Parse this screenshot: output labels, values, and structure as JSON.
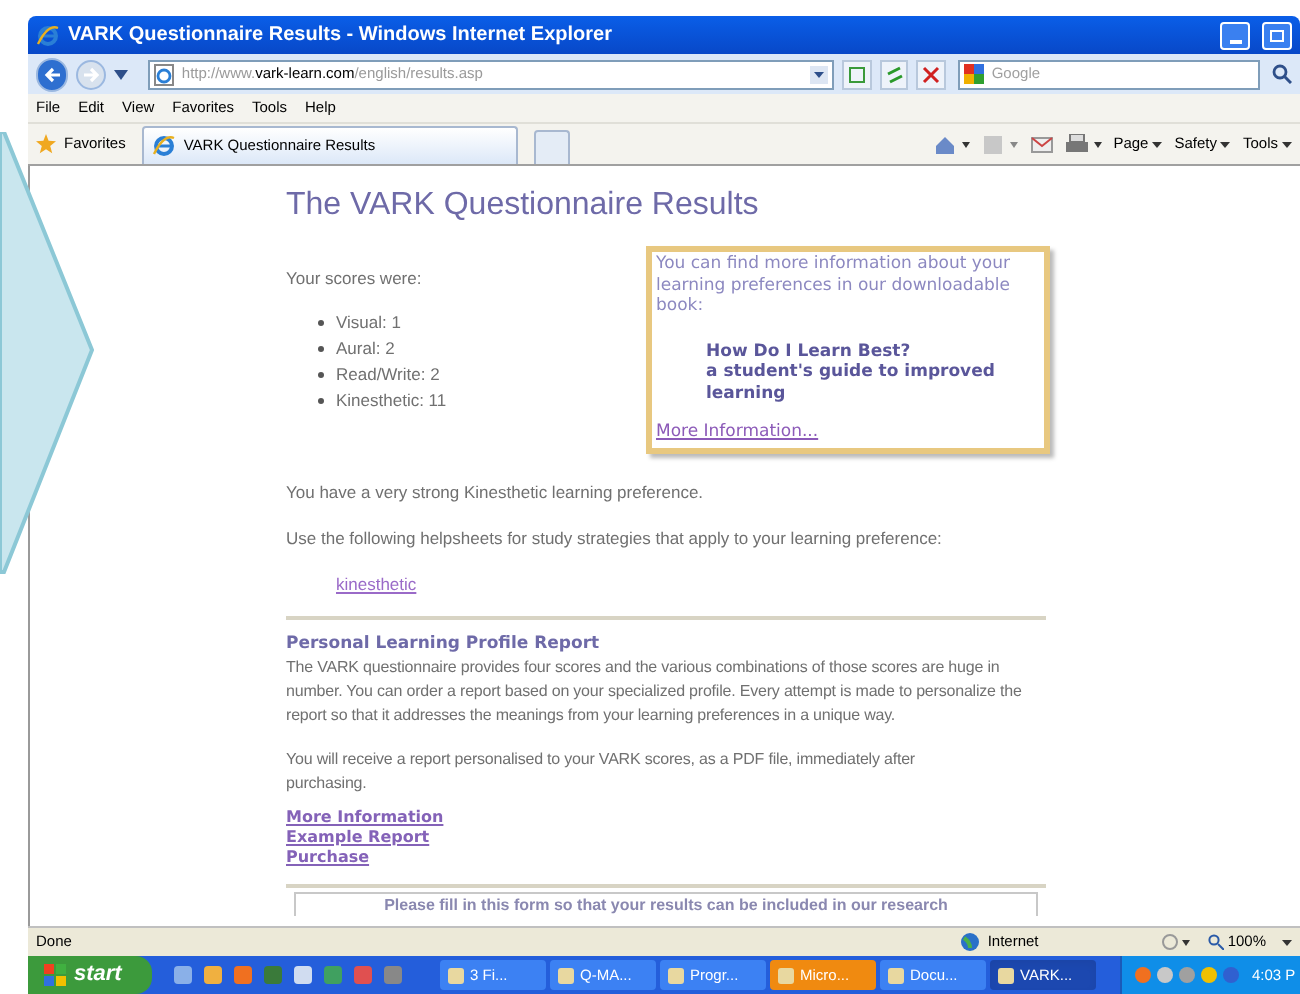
{
  "window": {
    "title": "VARK Questionnaire Results - Windows Internet Explorer"
  },
  "address_bar": {
    "prefix": "http://www.",
    "domain": "vark-learn.com",
    "path": "/english/results.asp"
  },
  "search": {
    "placeholder": "Google"
  },
  "menu": [
    "File",
    "Edit",
    "View",
    "Favorites",
    "Tools",
    "Help"
  ],
  "favorites_bar": {
    "label": "Favorites",
    "tabs": [
      {
        "label": "VARK Questionnaire Results",
        "selected": true
      }
    ],
    "commands": [
      "Page",
      "Safety",
      "Tools"
    ]
  },
  "page": {
    "title": "The VARK Questionnaire Results",
    "scores_intro": "Your scores were:",
    "scores": [
      "Visual: 1",
      "Aural: 2",
      "Read/Write: 2",
      "Kinesthetic: 11"
    ],
    "info_box": {
      "text": "You can find more information about your learning preferences in our downloadable book:",
      "book_title": "How Do I Learn Best?",
      "book_subtitle": "a student's guide to improved learning",
      "link": "More Information..."
    },
    "preference": "You have a very strong Kinesthetic learning preference.",
    "helpsheets_intro": "Use the following helpsheets for study strategies that apply to your learning preference:",
    "helpsheets": [
      "kinesthetic"
    ],
    "report": {
      "heading": "Personal Learning Profile Report",
      "paragraphs": [
        "The VARK questionnaire provides four scores and the various combinations of those scores are huge in number. You can order a report based on your specialized profile. Every attempt is made to personalize the report so that it addresses the meanings from your learning preferences in a unique way.",
        "You will receive a report personalised to your VARK scores, as a PDF file, immediately after purchasing."
      ],
      "links": [
        "More Information",
        "Example Report",
        "Purchase"
      ]
    },
    "form_note": "Please fill in this form so that your results can be included in our research"
  },
  "status_bar": {
    "text": "Done",
    "zone": "Internet",
    "zoom": "100%"
  },
  "taskbar": {
    "start": "start",
    "tasks": [
      {
        "label": "3 Fi...",
        "selected": false
      },
      {
        "label": "Q-MA...",
        "selected": false
      },
      {
        "label": "Progr...",
        "selected": false
      },
      {
        "label": "Micro...",
        "selected": false,
        "kind": "flash"
      },
      {
        "label": "Docu...",
        "selected": false
      },
      {
        "label": "VARK...",
        "selected": true
      }
    ],
    "clock": "4:03 P"
  }
}
